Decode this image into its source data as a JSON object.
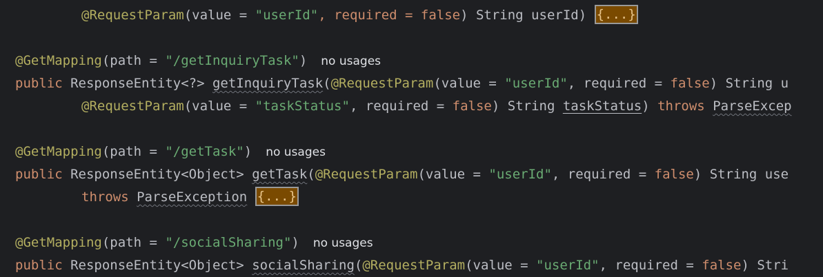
{
  "editor": {
    "lines": [
      {
        "segs": [
          "@RequestParam",
          "(value = ",
          "\"userId\"",
          ", required = ",
          "false",
          ") String userId) ",
          "{...}"
        ]
      },
      {
        "segs": [
          "@GetMapping",
          "(path = ",
          "\"/getInquiryTask\"",
          ")"
        ],
        "hint": "no usages"
      },
      {
        "segs": [
          "public",
          " ResponseEntity<?> ",
          "getInquiryTask",
          "(",
          "@RequestParam",
          "(value = ",
          "\"userId\"",
          ", required = ",
          "false",
          ") String u"
        ]
      },
      {
        "segs": [
          "@RequestParam",
          "(value = ",
          "\"taskStatus\"",
          ", required = ",
          "false",
          ") String ",
          "taskStatus",
          ") ",
          "throws",
          " ",
          "ParseExcep"
        ]
      },
      {
        "segs": [
          "@GetMapping",
          "(path = ",
          "\"/getTask\"",
          ")"
        ],
        "hint": "no usages"
      },
      {
        "segs": [
          "public",
          " ResponseEntity<Object> ",
          "getTask",
          "(",
          "@RequestParam",
          "(value = ",
          "\"userId\"",
          ", required = ",
          "false",
          ") String use"
        ]
      },
      {
        "segs": [
          "throws",
          " ",
          "ParseException",
          " ",
          "{...}"
        ]
      },
      {
        "segs": [
          "@GetMapping",
          "(path = ",
          "\"/socialSharing\"",
          ")"
        ],
        "hint": "no usages"
      },
      {
        "segs": [
          "public",
          " ResponseEntity<Object> ",
          "socialSharing",
          "(",
          "@RequestParam",
          "(value = ",
          "\"userId\"",
          ", required = ",
          "false",
          ") Stri"
        ]
      }
    ]
  },
  "colors": {
    "background": "#1e1f22",
    "keyword": "#cf8e6d",
    "annotation": "#b3ae60",
    "string": "#6aab73",
    "text": "#bcbec4",
    "fold_bg": "#7a4a00"
  }
}
